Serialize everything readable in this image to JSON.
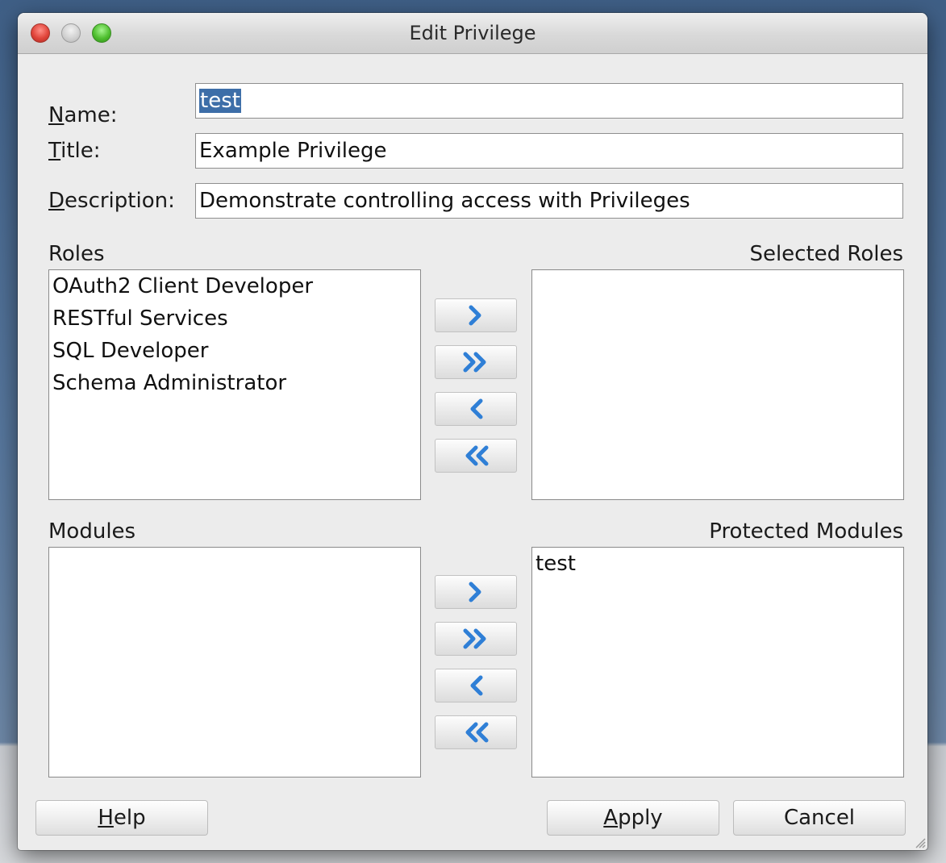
{
  "window": {
    "title": "Edit Privilege"
  },
  "form": {
    "name": {
      "label_mnemonic": "N",
      "label_rest": "ame:",
      "value": "test"
    },
    "title": {
      "label_mnemonic": "T",
      "label_rest": "itle:",
      "value": "Example Privilege"
    },
    "description": {
      "label_mnemonic": "D",
      "label_rest": "escription:",
      "value": "Demonstrate controlling access with Privileges"
    }
  },
  "roles": {
    "available_label": "Roles",
    "selected_label": "Selected Roles",
    "available_items": [
      "OAuth2 Client Developer",
      "RESTful Services",
      "SQL Developer",
      "Schema Administrator"
    ],
    "selected_items": []
  },
  "modules": {
    "available_label": "Modules",
    "selected_label": "Protected Modules",
    "available_items": [],
    "selected_items": [
      "test"
    ]
  },
  "shuttle_icons": [
    "chevron-right-icon",
    "double-chevron-right-icon",
    "chevron-left-icon",
    "double-chevron-left-icon"
  ],
  "buttons": {
    "help": {
      "mnemonic": "H",
      "rest": "elp"
    },
    "apply": {
      "mnemonic": "A",
      "rest": "pply"
    },
    "cancel": {
      "label": "Cancel"
    }
  },
  "colors": {
    "selection": "#3d6ea8",
    "shuttle_arrow": "#2f7fd6"
  }
}
